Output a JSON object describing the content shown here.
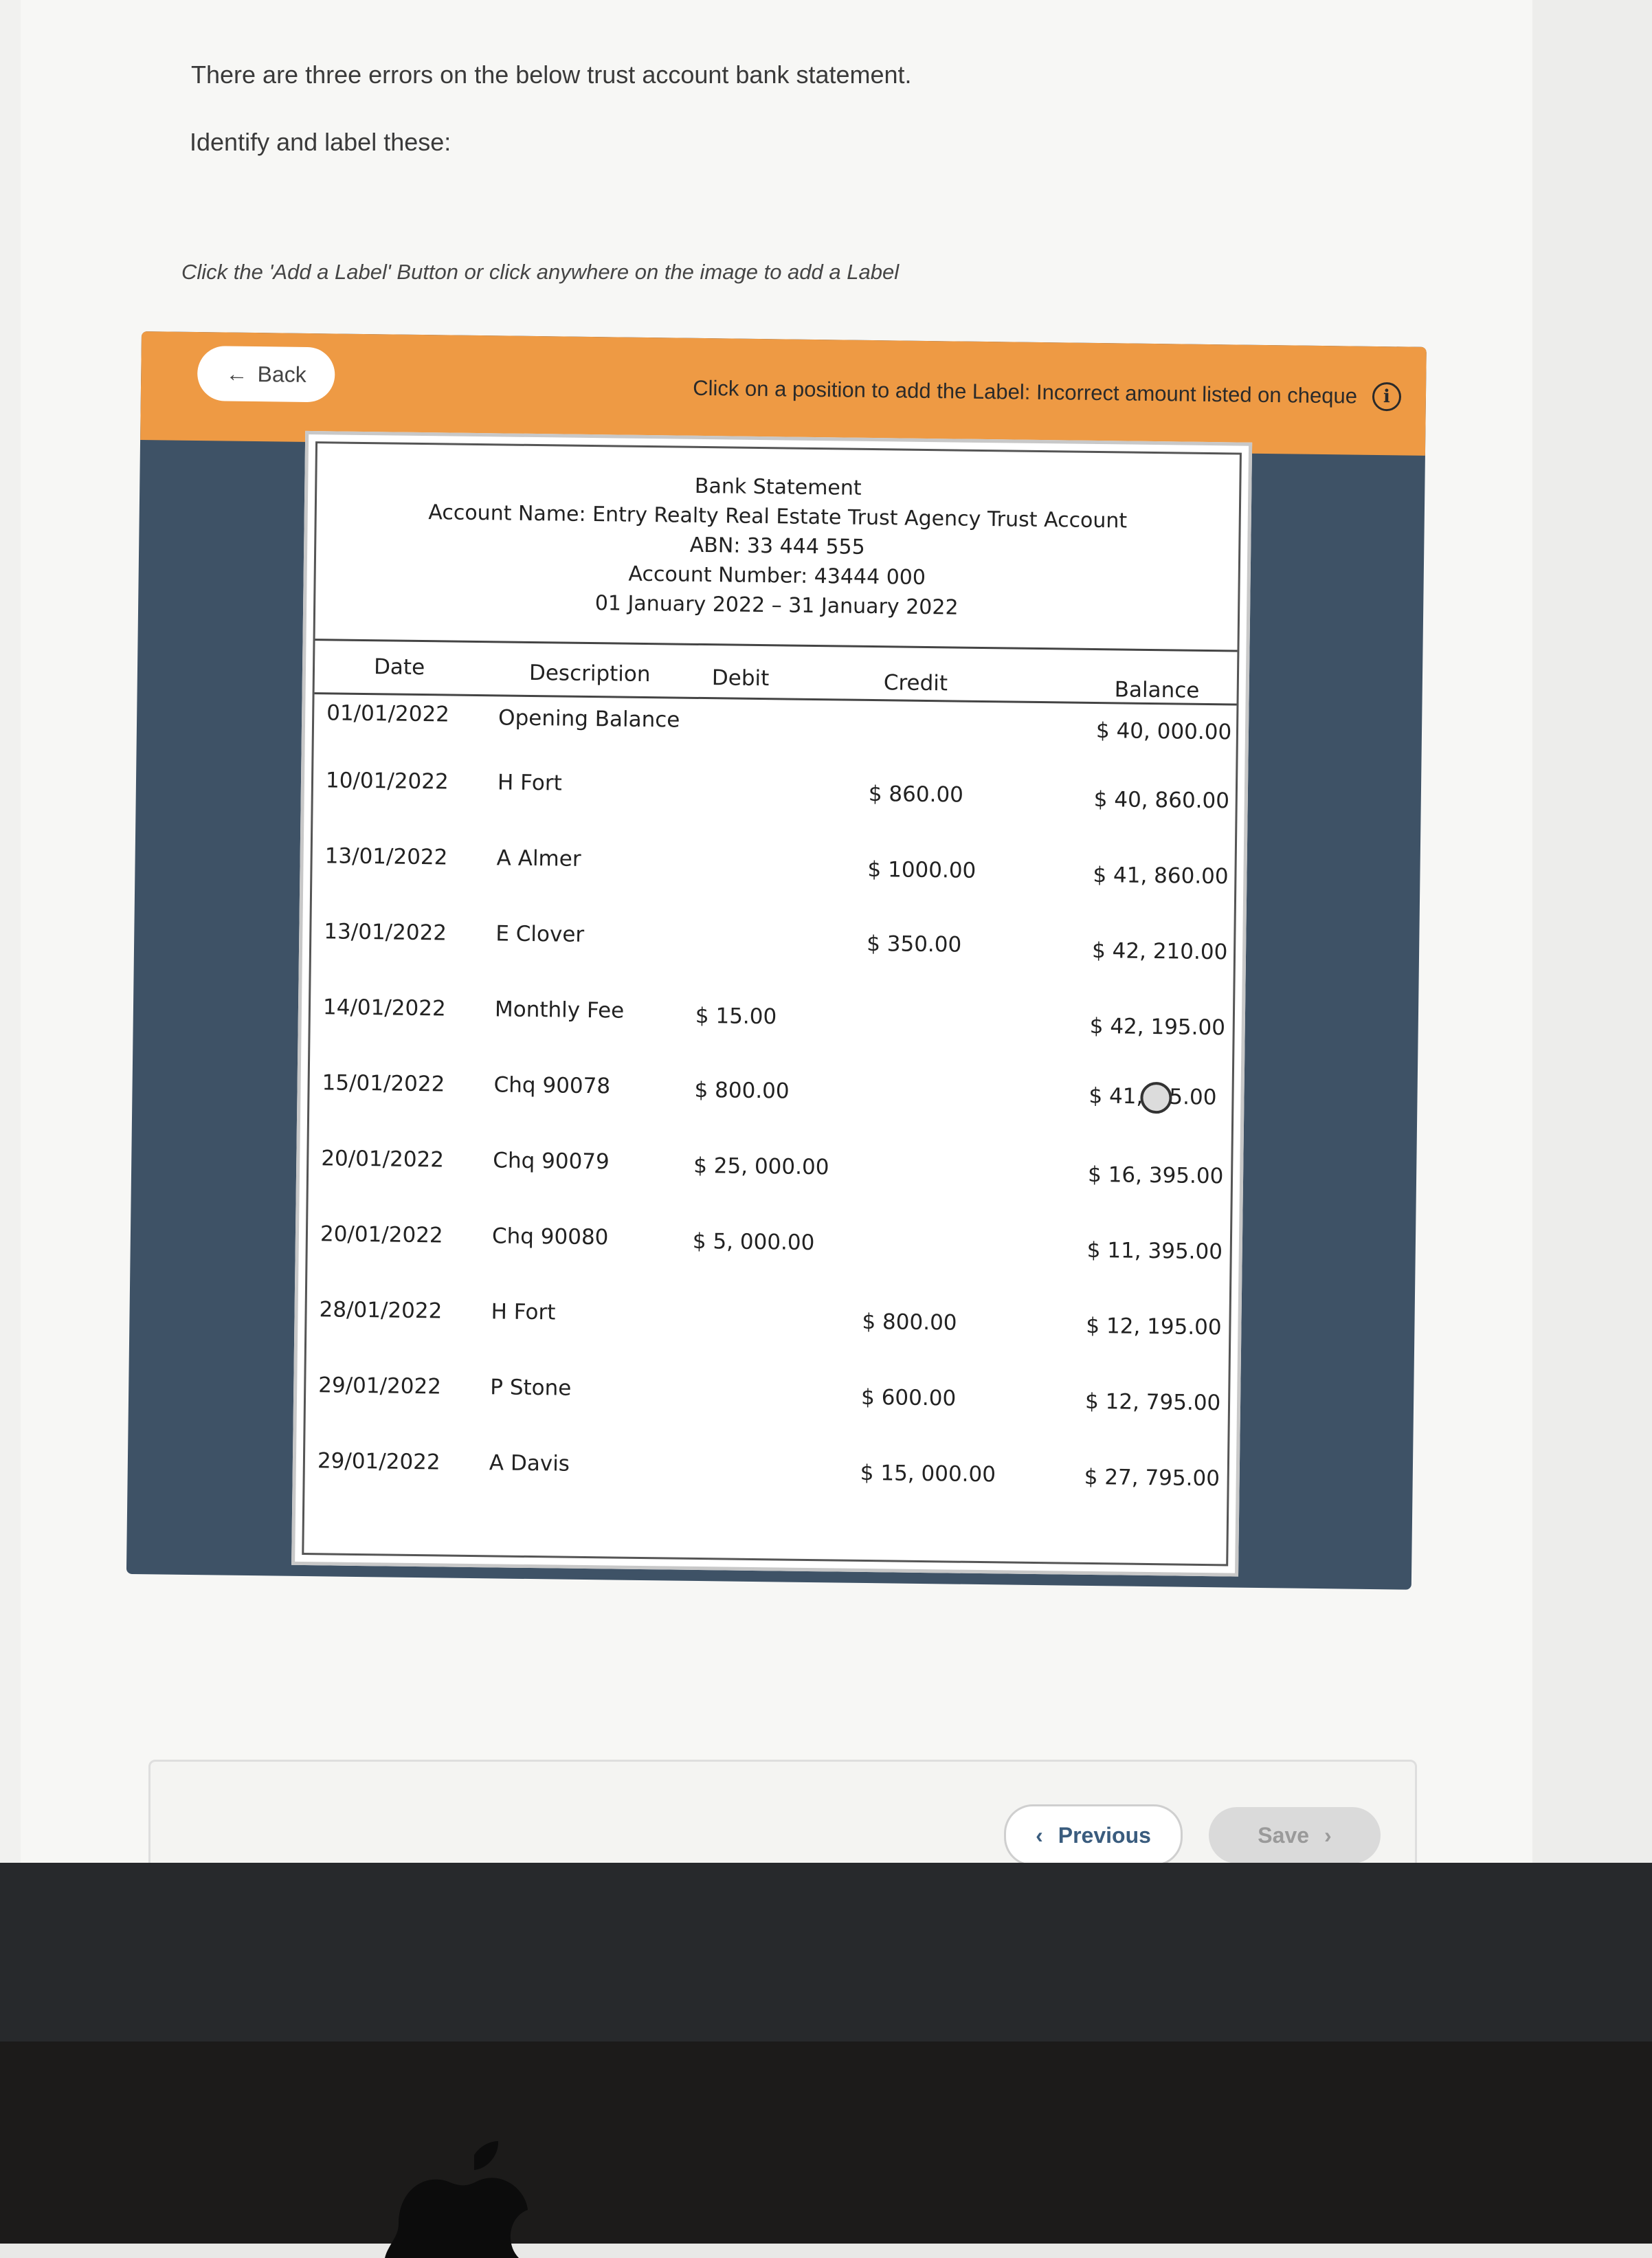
{
  "instructions": {
    "line1": "There are three errors on the below trust account bank statement.",
    "line2": "Identify and label these:",
    "hint": "Click the 'Add a Label' Button or click anywhere on the image to add a Label"
  },
  "toolbar": {
    "back_label": "Back",
    "back_icon": "←",
    "message": "Click on a position to add the Label: Incorrect amount listed on cheque",
    "info_icon": "i",
    "accent_color": "#ee9a44"
  },
  "statement": {
    "title": "Bank Statement",
    "account_name": "Account Name: Entry Realty Real Estate Trust Agency Trust Account",
    "abn": "ABN: 33 444 555",
    "account_number": "Account Number: 43444 000",
    "period": "01 January 2022 – 31 January 2022",
    "columns": {
      "date": "Date",
      "description": "Description",
      "debit": "Debit",
      "credit": "Credit",
      "balance": "Balance"
    },
    "rows": [
      {
        "date": "01/01/2022",
        "description": "Opening Balance",
        "debit": "",
        "credit": "",
        "balance": "$ 40, 000.00"
      },
      {
        "date": "10/01/2022",
        "description": "H Fort",
        "debit": "",
        "credit": "$ 860.00",
        "balance": "$ 40, 860.00"
      },
      {
        "date": "13/01/2022",
        "description": "A Almer",
        "debit": "",
        "credit": "$ 1000.00",
        "balance": "$ 41, 860.00"
      },
      {
        "date": "13/01/2022",
        "description": "E Clover",
        "debit": "",
        "credit": "$ 350.00",
        "balance": "$ 42, 210.00"
      },
      {
        "date": "14/01/2022",
        "description": "Monthly Fee",
        "debit": "$ 15.00",
        "credit": "",
        "balance": "$ 42, 195.00"
      },
      {
        "date": "15/01/2022",
        "description": "Chq 90078",
        "debit": "$ 800.00",
        "credit": "",
        "balance_prefix": "$ 41,",
        "balance_suffix": "5.00"
      },
      {
        "date": "20/01/2022",
        "description": "Chq 90079",
        "debit": "$ 25, 000.00",
        "credit": "",
        "balance": "$ 16, 395.00"
      },
      {
        "date": "20/01/2022",
        "description": "Chq 90080",
        "debit": "$ 5, 000.00",
        "credit": "",
        "balance": "$ 11, 395.00"
      },
      {
        "date": "28/01/2022",
        "description": "H Fort",
        "debit": "",
        "credit": "$ 800.00",
        "balance": "$ 12, 195.00"
      },
      {
        "date": "29/01/2022",
        "description": "P Stone",
        "debit": "",
        "credit": "$ 600.00",
        "balance": "$ 12, 795.00"
      },
      {
        "date": "29/01/2022",
        "description": "A Davis",
        "debit": "",
        "credit": "$ 15, 000.00",
        "balance": "$ 27, 795.00"
      }
    ]
  },
  "footer": {
    "previous_label": "Previous",
    "previous_icon": "‹",
    "save_label": "Save",
    "save_icon": "›"
  }
}
